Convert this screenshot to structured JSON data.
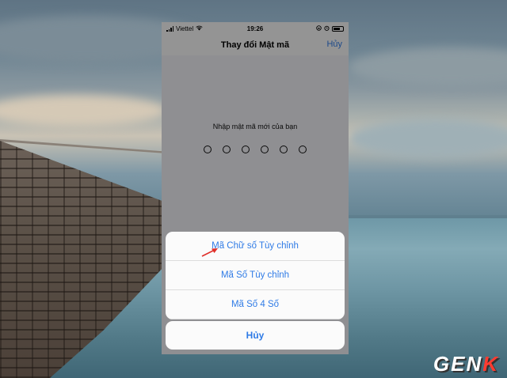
{
  "status_bar": {
    "carrier": "Viettel",
    "time": "19:26"
  },
  "nav": {
    "title": "Thay đổi Mật mã",
    "cancel": "Hủy"
  },
  "passcode": {
    "prompt": "Nhập mật mã mới của bạn",
    "digits": 6
  },
  "action_sheet": {
    "options": [
      {
        "label": "Mã Chữ số Tùy chỉnh"
      },
      {
        "label": "Mã Số Tùy chỉnh"
      },
      {
        "label": "Mã Số 4 Số"
      }
    ],
    "cancel": "Hủy"
  },
  "colors": {
    "ios_blue": "#2f7be6",
    "arrow_red": "#e0302a"
  },
  "watermark": {
    "text": "GENK"
  }
}
